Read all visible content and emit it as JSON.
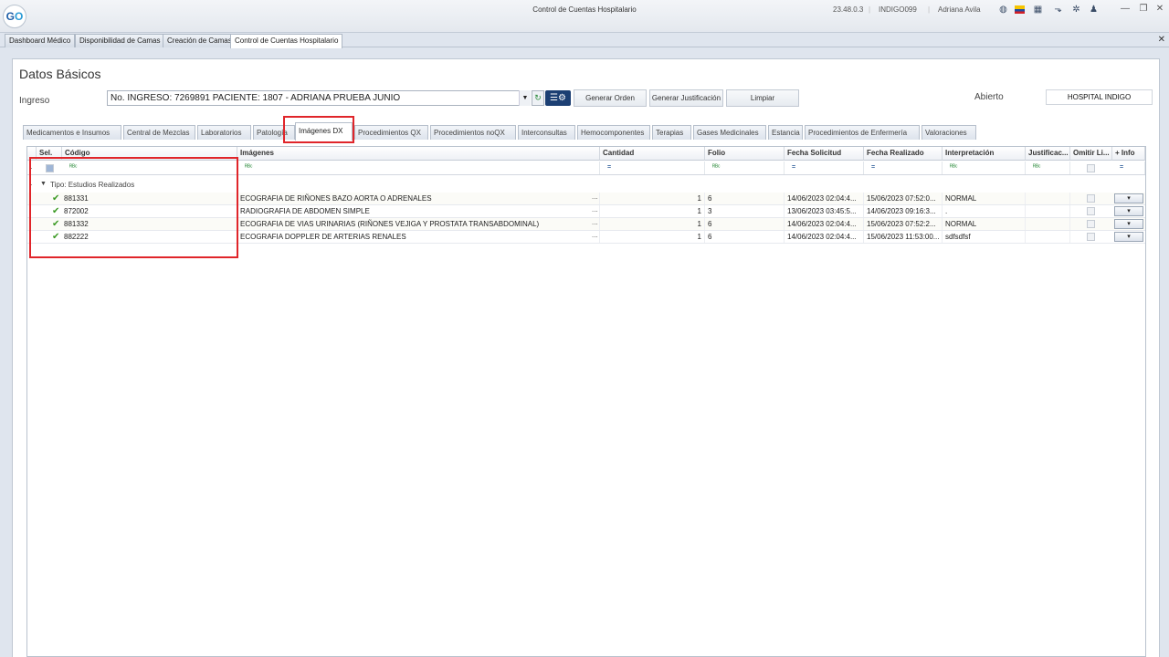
{
  "window": {
    "title": "Control de Cuentas Hospitalario",
    "status": {
      "time": "23.48.0.3",
      "db": "INDIGO099",
      "user": "Adriana Avila"
    },
    "logo": {
      "text_a": "G",
      "text_b": "O"
    }
  },
  "main_tabs": [
    {
      "label": "Dashboard Médico"
    },
    {
      "label": "Disponibilidad de Camas"
    },
    {
      "label": "Creación de Camas"
    },
    {
      "label": "Control de Cuentas Hospitalario",
      "active": true
    }
  ],
  "section_title": "Datos Básicos",
  "ingreso": {
    "label": "Ingreso",
    "value": "No. INGRESO: 7269891 PACIENTE: 1807 - ADRIANA  PRUEBA JUNIO"
  },
  "buttons": {
    "generar_orden": "Generar Orden",
    "generar_justificacion": "Generar Justificación",
    "limpiar": "Limpiar"
  },
  "estado": "Abierto",
  "hospital": "HOSPITAL INDIGO",
  "sub_tabs": [
    {
      "label": "Medicamentos e Insumos"
    },
    {
      "label": "Central de Mezclas"
    },
    {
      "label": "Laboratorios"
    },
    {
      "label": "Patología"
    },
    {
      "label": "Imágenes DX",
      "active": true
    },
    {
      "label": "Procedimientos QX"
    },
    {
      "label": "Procedimientos noQX"
    },
    {
      "label": "Interconsultas"
    },
    {
      "label": "Hemocomponentes"
    },
    {
      "label": "Terapias"
    },
    {
      "label": "Gases Medicinales"
    },
    {
      "label": "Estancia"
    },
    {
      "label": "Procedimientos de Enfermería"
    },
    {
      "label": "Valoraciones"
    }
  ],
  "grid": {
    "columns": [
      "Sel.",
      "Código",
      "Imágenes",
      "Cantidad",
      "Folio",
      "Fecha Solicitud",
      "Fecha Realizado",
      "Interpretación",
      "Justificac...",
      "Omitir Li...",
      "+ Info"
    ],
    "group_label": "Tipo: Estudios Realizados",
    "rows": [
      {
        "codigo": "881331",
        "imagen": "ECOGRAFIA DE RIÑONES  BAZO  AORTA O ADRENALES",
        "cantidad": "1",
        "folio": "6",
        "fecha_solicitud": "14/06/2023 02:04:4...",
        "fecha_realizado": "15/06/2023 07:52:0...",
        "interpretacion": "NORMAL"
      },
      {
        "codigo": "872002",
        "imagen": "RADIOGRAFIA DE ABDOMEN SIMPLE",
        "cantidad": "1",
        "folio": "3",
        "fecha_solicitud": "13/06/2023 03:45:5...",
        "fecha_realizado": "14/06/2023 09:16:3...",
        "interpretacion": "."
      },
      {
        "codigo": "881332",
        "imagen": "ECOGRAFIA DE VIAS URINARIAS (RIÑONES  VEJIGA Y PROSTATA TRANSABDOMINAL)",
        "cantidad": "1",
        "folio": "6",
        "fecha_solicitud": "14/06/2023 02:04:4...",
        "fecha_realizado": "15/06/2023 07:52:2...",
        "interpretacion": "NORMAL"
      },
      {
        "codigo": "882222",
        "imagen": "ECOGRAFIA DOPPLER DE ARTERIAS RENALES",
        "cantidad": "1",
        "folio": "6",
        "fecha_solicitud": "14/06/2023 02:04:4...",
        "fecha_realizado": "15/06/2023 11:53:00...",
        "interpretacion": "sdfsdfsf"
      }
    ]
  },
  "ellipsis": "..."
}
